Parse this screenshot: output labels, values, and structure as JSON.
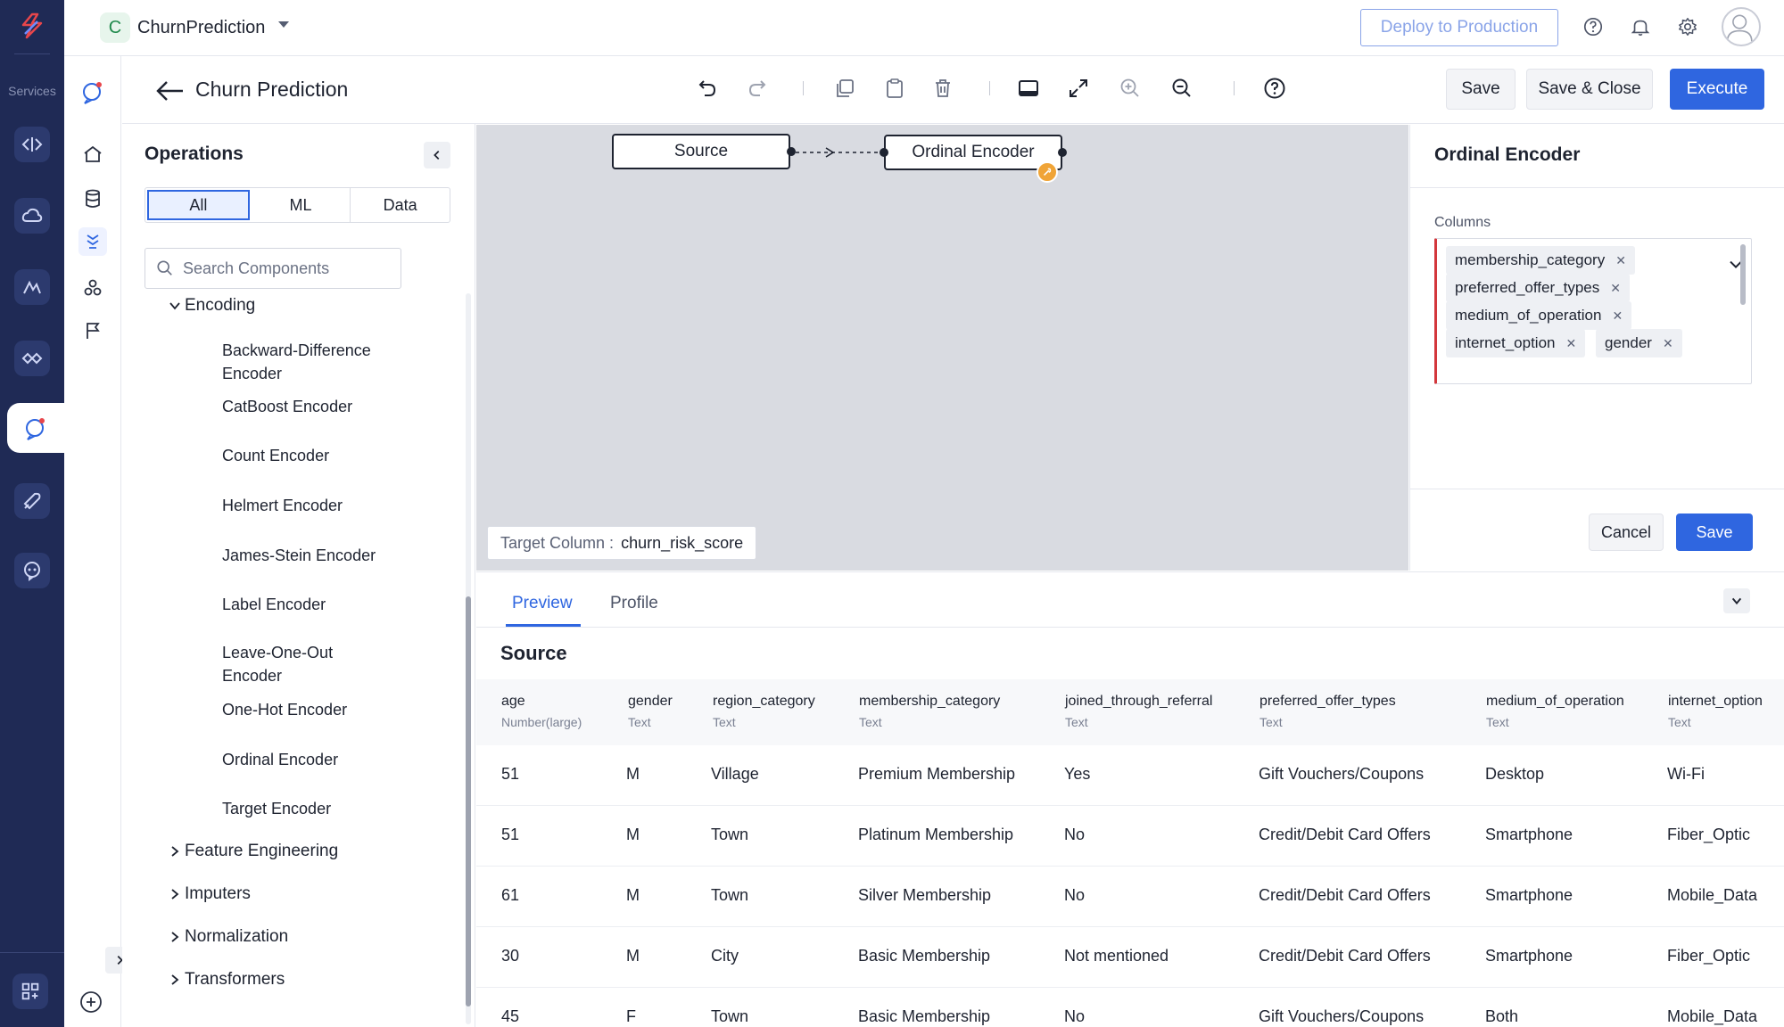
{
  "rail": {
    "services_label": "Services"
  },
  "topbar": {
    "project_initial": "C",
    "project_name": "ChurnPrediction",
    "deploy_label": "Deploy to Production"
  },
  "header": {
    "title": "Churn Prediction",
    "save_label": "Save",
    "save_close_label": "Save & Close",
    "execute_label": "Execute"
  },
  "operations": {
    "title": "Operations",
    "tabs": [
      "All",
      "ML",
      "Data"
    ],
    "active_tab": "All",
    "search_placeholder": "Search Components",
    "expanded_category": "Encoding",
    "items": [
      "Backward-Difference Encoder",
      "CatBoost Encoder",
      "Count Encoder",
      "Helmert Encoder",
      "James-Stein Encoder",
      "Label Encoder",
      "Leave-One-Out Encoder",
      "One-Hot Encoder",
      "Ordinal Encoder",
      "Target Encoder"
    ],
    "collapsed_categories": [
      "Feature Engineering",
      "Imputers",
      "Normalization",
      "Transformers"
    ]
  },
  "canvas": {
    "nodes": [
      "Source",
      "Ordinal Encoder"
    ],
    "target_label": "Target Column :",
    "target_value": "churn_risk_score"
  },
  "properties": {
    "title": "Ordinal Encoder",
    "columns_label": "Columns",
    "selected_columns": [
      "membership_category",
      "preferred_offer_types",
      "medium_of_operation",
      "internet_option",
      "gender"
    ],
    "cancel_label": "Cancel",
    "save_label": "Save"
  },
  "preview": {
    "tabs": [
      "Preview",
      "Profile"
    ],
    "active_tab": "Preview",
    "title": "Source",
    "columns": [
      {
        "name": "age",
        "type": "Number(large)"
      },
      {
        "name": "gender",
        "type": "Text"
      },
      {
        "name": "region_category",
        "type": "Text"
      },
      {
        "name": "membership_category",
        "type": "Text"
      },
      {
        "name": "joined_through_referral",
        "type": "Text"
      },
      {
        "name": "preferred_offer_types",
        "type": "Text"
      },
      {
        "name": "medium_of_operation",
        "type": "Text"
      },
      {
        "name": "internet_option",
        "type": "Text"
      }
    ],
    "rows": [
      [
        "51",
        "M",
        "Village",
        "Premium Membership",
        "Yes",
        "Gift Vouchers/Coupons",
        "Desktop",
        "Wi-Fi"
      ],
      [
        "51",
        "M",
        "Town",
        "Platinum Membership",
        "No",
        "Credit/Debit Card Offers",
        "Smartphone",
        "Fiber_Optic"
      ],
      [
        "61",
        "M",
        "Town",
        "Silver Membership",
        "No",
        "Credit/Debit Card Offers",
        "Smartphone",
        "Mobile_Data"
      ],
      [
        "30",
        "M",
        "City",
        "Basic Membership",
        "Not mentioned",
        "Credit/Debit Card Offers",
        "Smartphone",
        "Fiber_Optic"
      ],
      [
        "45",
        "F",
        "Town",
        "Basic Membership",
        "No",
        "Gift Vouchers/Coupons",
        "Both",
        "Mobile_Data"
      ]
    ]
  },
  "colors": {
    "rail_bg": "#1f2a55",
    "accent": "#2f66e0",
    "warning": "#f0a437",
    "error_border": "#d3373c"
  }
}
